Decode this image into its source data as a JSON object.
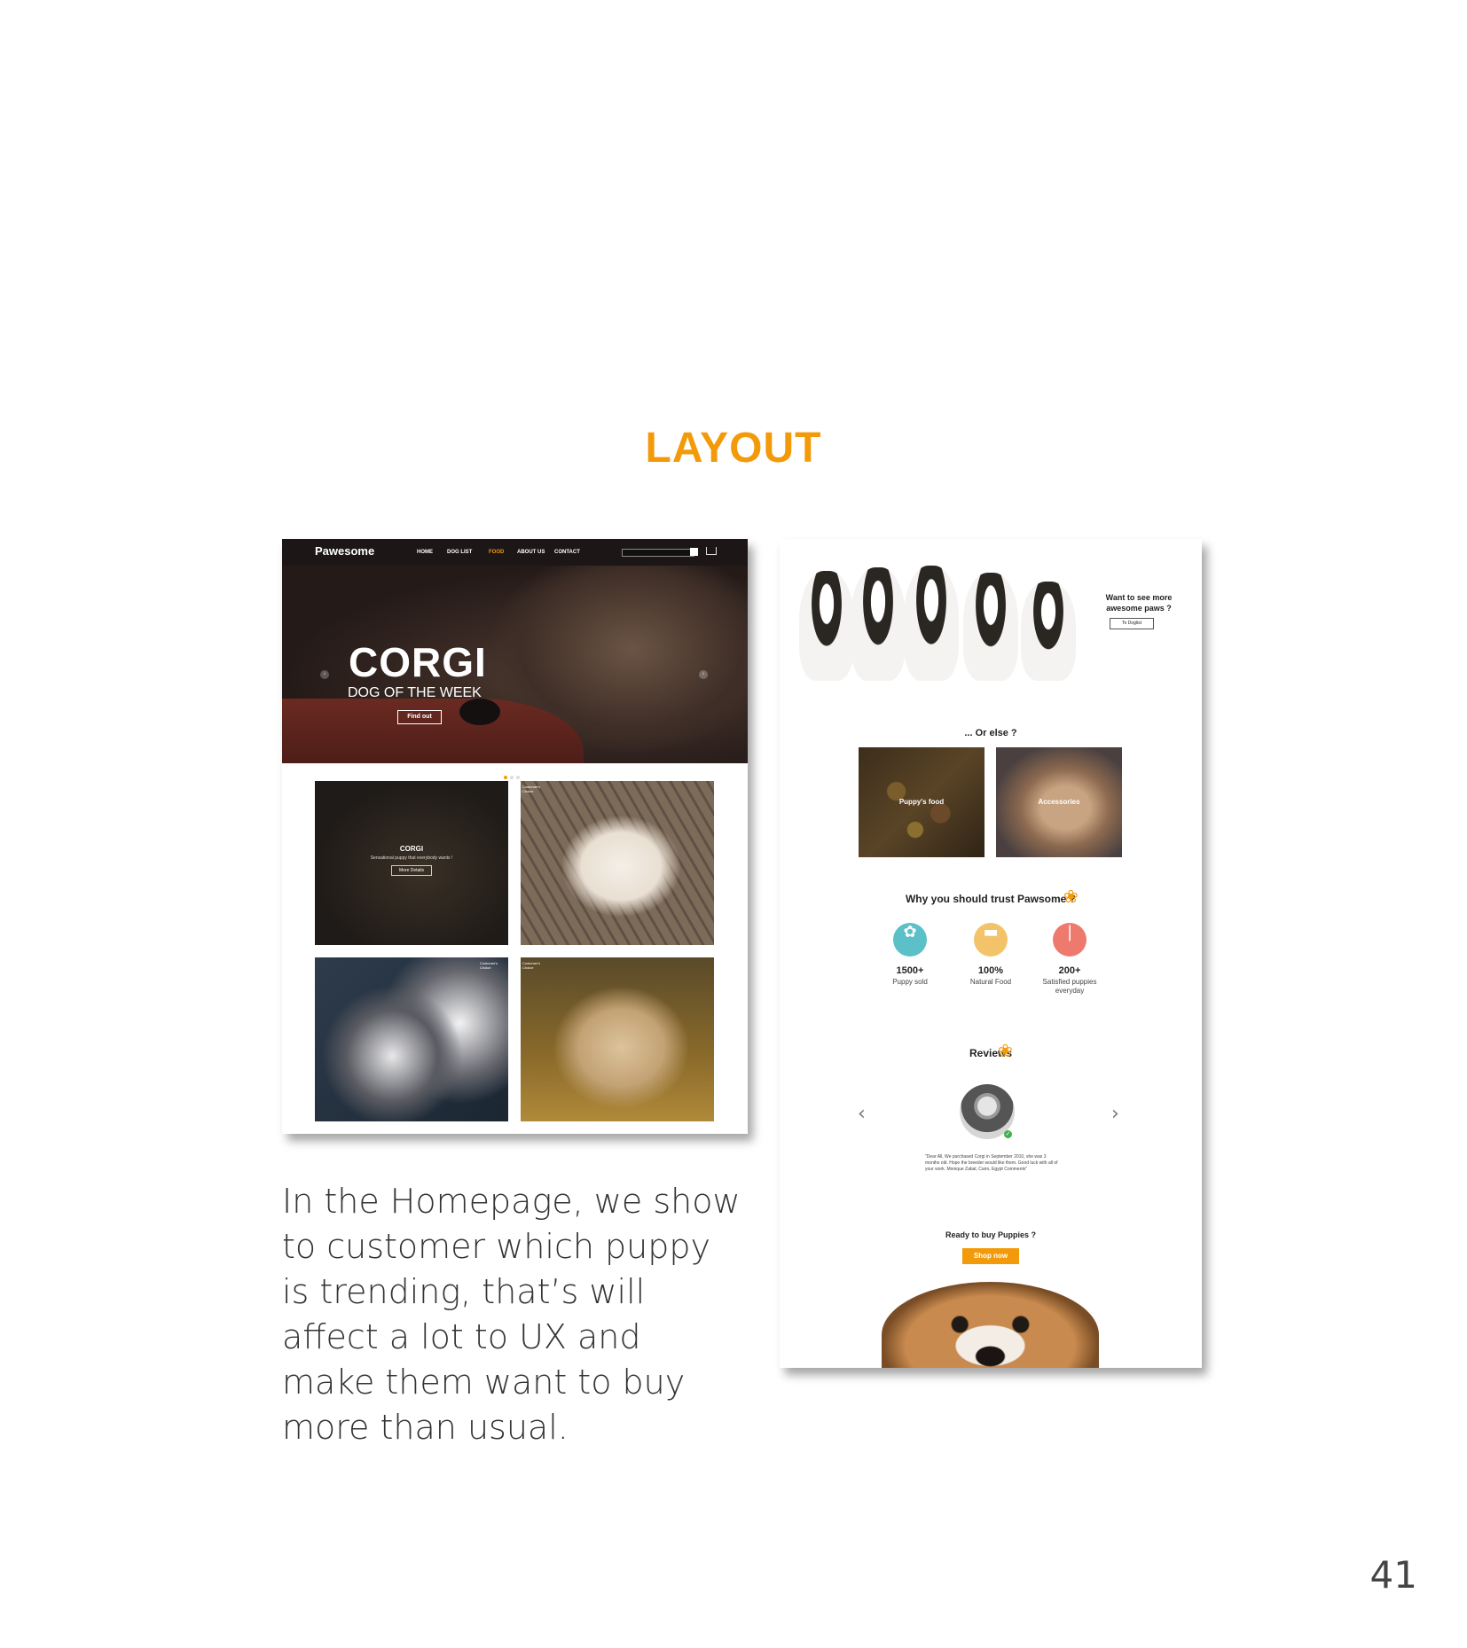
{
  "slide": {
    "title": "LAYOUT",
    "caption": "In the Homepage, we show to customer which puppy is trending, that’s will affect a lot to UX and make them want to buy more than usual.",
    "page_number": "41",
    "accent_color": "#f29a0a"
  },
  "home": {
    "logo": "Pawesome",
    "nav": [
      "HOME",
      "DOG LIST",
      "FOOD",
      "ABOUT US",
      "CONTACT"
    ],
    "active_nav": "FOOD",
    "hero_title": "CORGI",
    "hero_subtitle": "DOG OF THE WEEK",
    "hero_button": "Find out",
    "tile_title": "CORGI",
    "tile_subtitle": "Sensational puppy that everybody wants !",
    "tile_button": "More Details",
    "badge": "Customer's Choice"
  },
  "landing": {
    "want_more": "Want to see more awesome paws ?",
    "doglist_button": "To Doglist",
    "or_else": "... Or else ?",
    "categories": [
      "Puppy's food",
      "Accessories"
    ],
    "trust_title": "Why you should trust Pawsome ?",
    "stats": [
      {
        "value": "1500+",
        "label": "Puppy sold",
        "icon": "paw-icon",
        "color": "#5bc0c8"
      },
      {
        "value": "100%",
        "label": "Natural Food",
        "icon": "food-bowl-icon",
        "color": "#f3c36a"
      },
      {
        "value": "200+",
        "label": "Satisfied puppies everyday",
        "icon": "brush-icon",
        "color": "#ee7a6e"
      }
    ],
    "reviews_title": "Reviews",
    "review_quote": "\"Dear All, We purchased Corgi in September 2010, she was 3 months old. Hope the breeder would like them. Good luck with all of your work. Monique Zabal, Cairo, Egypt Comments\"",
    "ready": "Ready to buy Puppies ?",
    "shop_button": "Shop now"
  }
}
